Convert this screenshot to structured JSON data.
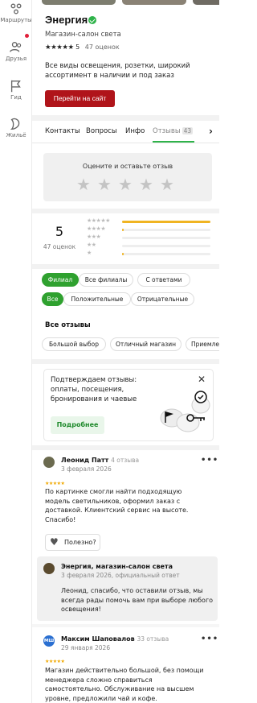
{
  "rail": {
    "items": [
      {
        "label": "Маршруты",
        "icon": "route-icon"
      },
      {
        "label": "Друзья",
        "icon": "friends-icon"
      },
      {
        "label": "Гид",
        "icon": "guide-flag-icon"
      },
      {
        "label": "Жильё",
        "icon": "housing-icon"
      }
    ],
    "notification_color": "#e0203a"
  },
  "place": {
    "name": "Энергия",
    "category": "Магазин-салон света",
    "rating": "5",
    "rating_stars": "★★★★★",
    "reviews_count": "47 оценок",
    "description": "Все виды освещения, розетки, широкий ассортимент в наличии и под заказ",
    "site_button": "Перейти на сайт"
  },
  "tabs": {
    "items": [
      "Контакты",
      "Вопросы",
      "Инфо"
    ],
    "active": "Отзывы",
    "active_count": "43",
    "arrow": "›"
  },
  "rate": {
    "title": "Оцените и оставьте отзыв",
    "star": "★"
  },
  "summary": {
    "rating": "5",
    "count": "47 оценок",
    "distribution": [
      {
        "stars": "★★★★★",
        "fraction": 1.0
      },
      {
        "stars": "★★★★",
        "fraction": 0.02
      },
      {
        "stars": "★★★",
        "fraction": 0.0
      },
      {
        "stars": "★★",
        "fraction": 0.0
      },
      {
        "stars": "★",
        "fraction": 0.02
      }
    ]
  },
  "filters": {
    "branch": [
      "Филиал",
      "Все филиалы",
      "С ответами"
    ],
    "sentiment": [
      "Все",
      "Положительные",
      "Отрицательные"
    ]
  },
  "all_reviews_label": "Все отзывы",
  "tags": [
    "Большой выбор",
    "Отличный магазин",
    "Приемле"
  ],
  "promo": {
    "text": "Подтверждаем отзывы: оплаты, посещения, бронирования и чаевые",
    "button": "Подробнее",
    "close": "✕"
  },
  "reviews": [
    {
      "author": "Леонид Патт",
      "author_reviews": "4 отзыва",
      "date": "3 февраля 2026",
      "stars": "★★★★★",
      "text": "По картинке смогли найти подходящую модель светильников, оформил заказ с доставкой. Клиентский сервис на высоте. Спасибо!",
      "useful": "Полезно?",
      "more": "•••"
    },
    {
      "author": "Максим Шаповалов",
      "author_reviews": "33 отзыва",
      "date": "29 января 2026",
      "stars": "★★★★★",
      "avatar_initials": "МШ",
      "text": "Магазин действительно большой, без помощи менеджера сложно справиться самостоятельно. Обслуживание на высшем уровне, предложили чай и кофе.",
      "more": "•••"
    }
  ],
  "owner_reply": {
    "name": "Энергия, магазин-салон света",
    "date": "3 февраля 2026, официальный ответ",
    "text": "Леонид, спасибо, что оставили отзыв, мы всегда рады помочь вам при выборе любого освещения!"
  },
  "colors": {
    "accent": "#2fa12f",
    "brand_button": "#b0141a",
    "star_yellow": "#f0b422"
  }
}
